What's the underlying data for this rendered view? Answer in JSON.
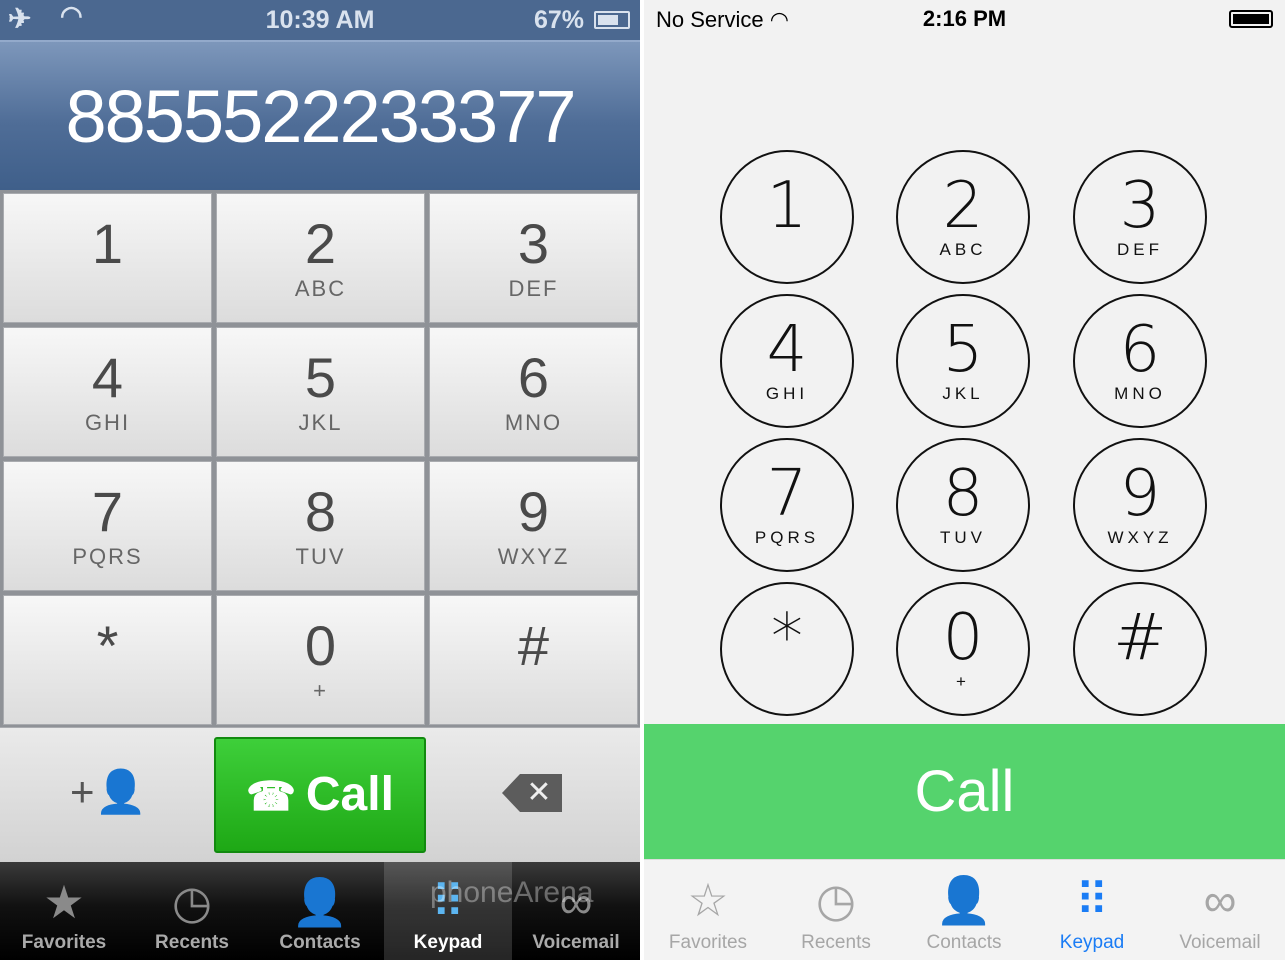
{
  "left": {
    "status": {
      "airplane_icon": "airplane-icon",
      "wifi_icon": "wifi-icon",
      "time": "10:39 AM",
      "battery": "67%"
    },
    "number": "8855522233377",
    "keys": [
      {
        "d": "1",
        "s": ""
      },
      {
        "d": "2",
        "s": "ABC"
      },
      {
        "d": "3",
        "s": "DEF"
      },
      {
        "d": "4",
        "s": "GHI"
      },
      {
        "d": "5",
        "s": "JKL"
      },
      {
        "d": "6",
        "s": "MNO"
      },
      {
        "d": "7",
        "s": "PQRS"
      },
      {
        "d": "8",
        "s": "TUV"
      },
      {
        "d": "9",
        "s": "WXYZ"
      },
      {
        "d": "*",
        "s": ""
      },
      {
        "d": "0",
        "s": "+"
      },
      {
        "d": "#",
        "s": ""
      }
    ],
    "add_contact": "+👤",
    "call": "Call",
    "call_icon": "☎",
    "delete": "✕",
    "tabs": [
      {
        "label": "Favorites",
        "icon": "★"
      },
      {
        "label": "Recents",
        "icon": "◷"
      },
      {
        "label": "Contacts",
        "icon": "👤"
      },
      {
        "label": "Keypad",
        "icon": "⠿",
        "active": true
      },
      {
        "label": "Voicemail",
        "icon": "∞"
      }
    ],
    "watermark": "phoneArena"
  },
  "right": {
    "status": {
      "carrier": "No Service",
      "wifi_icon": "wifi-icon",
      "time": "2:16 PM"
    },
    "keys": [
      {
        "d": "1",
        "s": ""
      },
      {
        "d": "2",
        "s": "ABC"
      },
      {
        "d": "3",
        "s": "DEF"
      },
      {
        "d": "4",
        "s": "GHI"
      },
      {
        "d": "5",
        "s": "JKL"
      },
      {
        "d": "6",
        "s": "MNO"
      },
      {
        "d": "7",
        "s": "PQRS"
      },
      {
        "d": "8",
        "s": "TUV"
      },
      {
        "d": "9",
        "s": "WXYZ"
      },
      {
        "d": "*",
        "s": ""
      },
      {
        "d": "0",
        "s": "+"
      },
      {
        "d": "#",
        "s": ""
      }
    ],
    "call": "Call",
    "tabs": [
      {
        "label": "Favorites",
        "icon": "☆"
      },
      {
        "label": "Recents",
        "icon": "◷"
      },
      {
        "label": "Contacts",
        "icon": "👤"
      },
      {
        "label": "Keypad",
        "icon": "⠿",
        "active": true
      },
      {
        "label": "Voicemail",
        "icon": "∞"
      }
    ]
  },
  "colors": {
    "left_call": "#1ea815",
    "right_call": "#55d36d",
    "right_active_tab": "#1a7cf5"
  }
}
